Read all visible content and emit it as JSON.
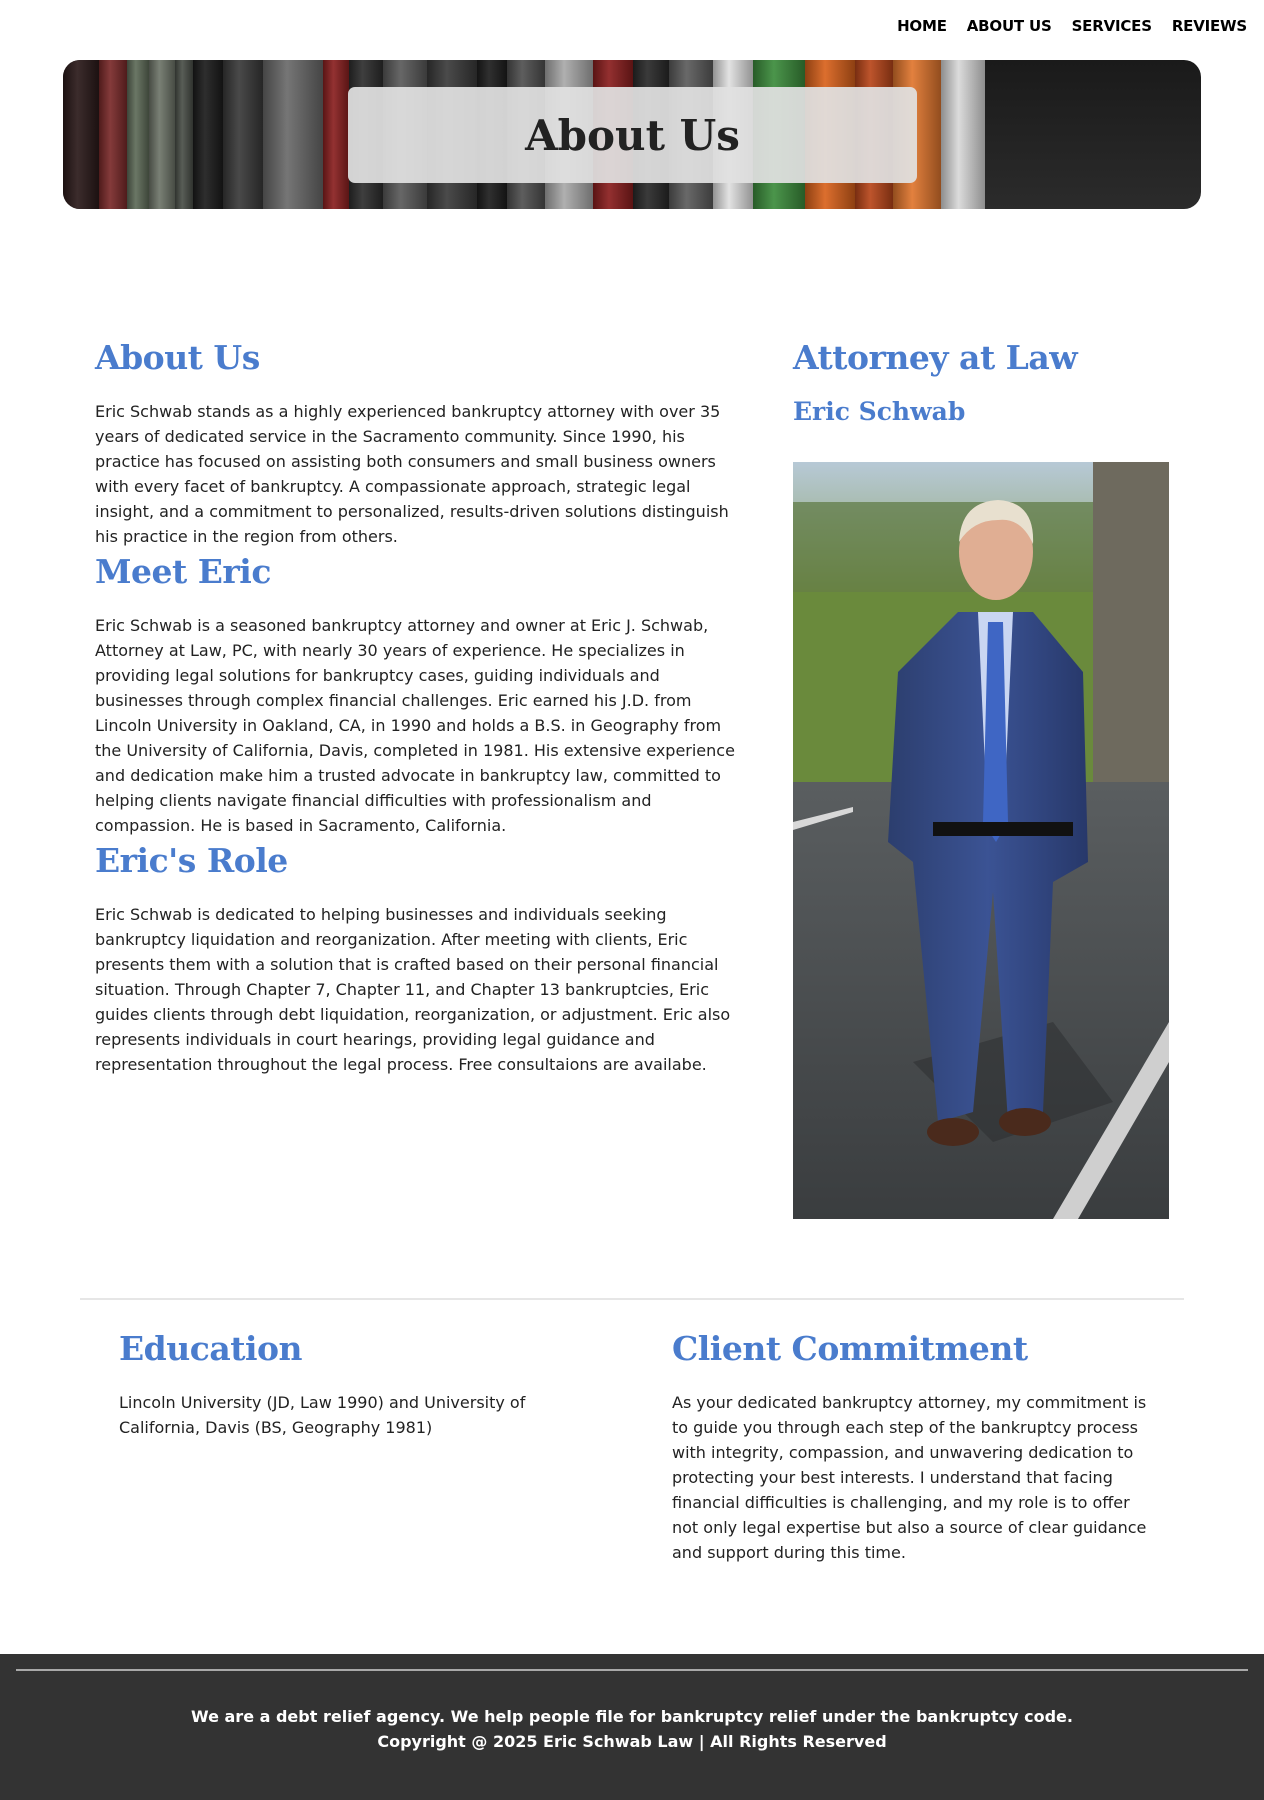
{
  "nav": {
    "items": [
      {
        "label": "HOME"
      },
      {
        "label": "ABOUT US"
      },
      {
        "label": "SERVICES"
      },
      {
        "label": "REVIEWS"
      }
    ]
  },
  "hero": {
    "title": "About Us",
    "book_colors": [
      "#2b1a1a",
      "#7a2a2a",
      "#5e6b58",
      "#6e7569",
      "#4a4f48",
      "#1c1c1c",
      "#3a3a3a",
      "#6a6a6a",
      "#8a2020",
      "#2e2e2e",
      "#5a5a5a",
      "#3b3b3b",
      "#1e1e1e",
      "#505050",
      "#a9a9a9",
      "#8a1e1e",
      "#2a2a2a",
      "#5c5c5c",
      "#e0e0e0",
      "#3c8c3c",
      "#d9621c",
      "#b8461a",
      "#e0762e",
      "#d9d9d9"
    ]
  },
  "main": {
    "about": {
      "heading": "About Us",
      "text": "Eric Schwab stands as a highly experienced bankruptcy attorney with over 35 years of dedicated service in the Sacramento community. Since 1990, his practice has focused on assisting both consumers and small business owners with every facet of bankruptcy. A compassionate approach, strategic legal insight, and a commitment to personalized, results-driven solutions distinguish his practice in the region from others."
    },
    "meet": {
      "heading": "Meet Eric",
      "text": "Eric Schwab is a seasoned bankruptcy attorney and owner at Eric J. Schwab, Attorney at Law, PC, with nearly 30 years of experience. He specializes in providing legal solutions for bankruptcy cases, guiding individuals and businesses through complex financial challenges. Eric earned his J.D. from Lincoln University in Oakland, CA, in 1990 and holds a B.S. in Geography from the University of California, Davis, completed in 1981. His extensive experience and dedication make him a trusted advocate in bankruptcy law, committed to helping clients navigate financial difficulties with professionalism and compassion. He is based in Sacramento, California."
    },
    "role": {
      "heading": "Eric's Role",
      "text": "Eric Schwab is dedicated to helping businesses and individuals seeking bankruptcy liquidation and reorganization. After meeting with clients, Eric presents them with a solution that is crafted based on their personal financial situation. Through Chapter 7, Chapter 11, and Chapter 13 bankruptcies, Eric guides clients through debt liquidation, reorganization, or adjustment. Eric also represents individuals in court hearings, providing legal guidance and representation throughout the legal process. Free consultaions are availabe."
    }
  },
  "sidebar": {
    "heading": "Attorney at Law",
    "name": "Eric Schwab"
  },
  "education": {
    "heading": "Education",
    "text": "Lincoln University (JD, Law 1990) and University of California, Davis (BS, Geography 1981)"
  },
  "commitment": {
    "heading": "Client Commitment",
    "text": "As your dedicated bankruptcy attorney, my commitment is to guide you through each step of the bankruptcy process with integrity, compassion, and unwavering dedication to protecting your best interests. I understand that facing financial difficulties is challenging, and my role is to offer not only legal expertise but also a source of clear guidance and support during this time."
  },
  "footer": {
    "line1": "We are a debt relief agency. We help people file for bankruptcy relief under the bankruptcy code.",
    "line2": "Copyright @ 2025 Eric Schwab Law | All Rights Reserved"
  },
  "colors": {
    "accent": "#4a7ccd",
    "footer_bg": "#333333"
  }
}
